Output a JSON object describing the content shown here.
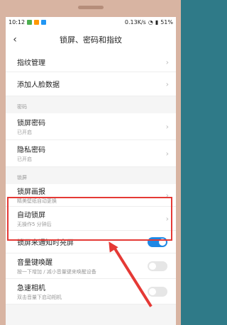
{
  "status_bar": {
    "time": "10:12",
    "network_speed": "0.13K/s",
    "battery": "51%"
  },
  "header": {
    "title": "锁屏、密码和指纹"
  },
  "items": {
    "fingerprint": {
      "label": "指纹管理"
    },
    "face": {
      "label": "添加人脸数据"
    },
    "section_password": "密码",
    "lock_password": {
      "label": "锁屏密码",
      "sub": "已开启"
    },
    "privacy_password": {
      "label": "隐私密码",
      "sub": "已开启"
    },
    "section_lock": "锁屏",
    "lock_wallpaper": {
      "label": "锁屏画报",
      "sub": "精美壁纸自动更换"
    },
    "auto_lock": {
      "label": "自动锁屏",
      "sub": "无操作5 分钟后"
    },
    "notify_wake": {
      "label": "锁屏来通知时亮屏",
      "toggle_on": true
    },
    "volume_wake": {
      "label": "音量键唤醒",
      "sub": "按一下增加 / 减小音量键来唤醒设备",
      "toggle_on": false
    },
    "quick_camera": {
      "label": "急速相机",
      "sub": "双击音量下启动相机",
      "toggle_on": false
    }
  },
  "colors": {
    "annotation_red": "#e53935",
    "toggle_on": "#1e88e5"
  }
}
